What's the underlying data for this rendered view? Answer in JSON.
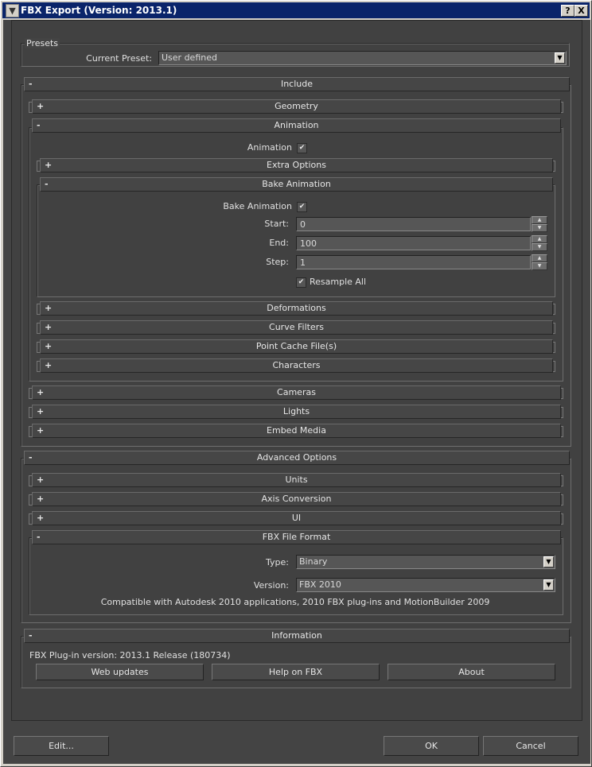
{
  "window": {
    "title": "FBX Export (Version: 2013.1)",
    "help_btn": "?",
    "close_btn": "X",
    "app_icon": "3ds-max-logo-icon"
  },
  "presets": {
    "group_label": "Presets",
    "current_preset_label": "Current Preset:",
    "current_preset_value": "User defined"
  },
  "include": {
    "sign": "-",
    "title": "Include",
    "geometry": {
      "sign": "+",
      "title": "Geometry"
    },
    "animation": {
      "sign": "-",
      "title": "Animation",
      "animation_label": "Animation",
      "animation_checked": true,
      "extra_options": {
        "sign": "+",
        "title": "Extra Options"
      },
      "bake_animation": {
        "sign": "-",
        "title": "Bake Animation",
        "bake_label": "Bake Animation",
        "bake_checked": true,
        "start_label": "Start:",
        "start_value": "0",
        "end_label": "End:",
        "end_value": "100",
        "step_label": "Step:",
        "step_value": "1",
        "resample_label": "Resample All",
        "resample_checked": true
      },
      "deformations": {
        "sign": "+",
        "title": "Deformations"
      },
      "curve_filters": {
        "sign": "+",
        "title": "Curve Filters"
      },
      "point_cache": {
        "sign": "+",
        "title": "Point Cache File(s)"
      },
      "characters": {
        "sign": "+",
        "title": "Characters"
      }
    },
    "cameras": {
      "sign": "+",
      "title": "Cameras"
    },
    "lights": {
      "sign": "+",
      "title": "Lights"
    },
    "embed_media": {
      "sign": "+",
      "title": "Embed Media"
    }
  },
  "advanced": {
    "sign": "-",
    "title": "Advanced Options",
    "units": {
      "sign": "+",
      "title": "Units"
    },
    "axis_conversion": {
      "sign": "+",
      "title": "Axis Conversion"
    },
    "ui": {
      "sign": "+",
      "title": "UI"
    },
    "fbx_file_format": {
      "sign": "-",
      "title": "FBX File Format",
      "type_label": "Type:",
      "type_value": "Binary",
      "version_label": "Version:",
      "version_value": "FBX 2010",
      "compat_text": "Compatible with Autodesk 2010 applications, 2010 FBX plug-ins and MotionBuilder 2009"
    }
  },
  "information": {
    "sign": "-",
    "title": "Information",
    "plugin_version": "FBX Plug-in version: 2013.1 Release (180734)",
    "web_updates": "Web updates",
    "help_on_fbx": "Help on FBX",
    "about": "About"
  },
  "footer": {
    "edit": "Edit...",
    "ok": "OK",
    "cancel": "Cancel"
  },
  "colors": {
    "titlebar": "#0a246a",
    "panel_bg": "#444444",
    "rollout_bg": "#464646",
    "text": "#e6e6e6"
  }
}
